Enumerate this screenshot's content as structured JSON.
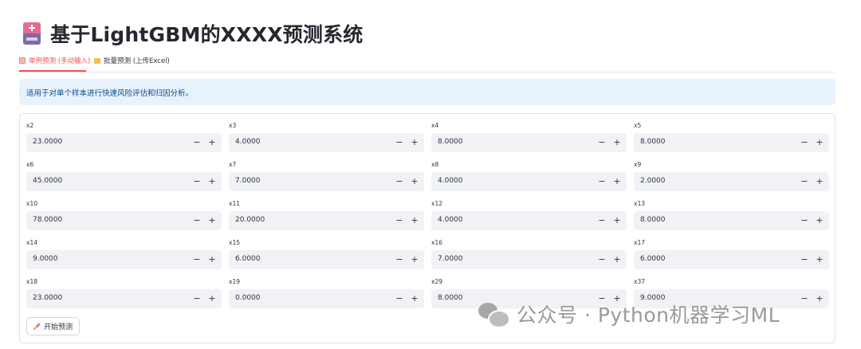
{
  "header": {
    "title": "基于LightGBM的XXXX预测系统",
    "icon": "hospital-icon"
  },
  "tabs": [
    {
      "label": "单例预测 (手动输入)",
      "icon": "memo-icon",
      "active": true
    },
    {
      "label": "批量预测 (上传Excel)",
      "icon": "folder-icon",
      "active": false
    }
  ],
  "info": {
    "text": "适用于对单个样本进行快速风险评估和归因分析。"
  },
  "fields": [
    {
      "label": "x2",
      "value": "23.0000"
    },
    {
      "label": "x3",
      "value": "4.0000"
    },
    {
      "label": "x4",
      "value": "8.0000"
    },
    {
      "label": "x5",
      "value": "8.0000"
    },
    {
      "label": "x6",
      "value": "45.0000"
    },
    {
      "label": "x7",
      "value": "7.0000"
    },
    {
      "label": "x8",
      "value": "4.0000"
    },
    {
      "label": "x9",
      "value": "2.0000"
    },
    {
      "label": "x10",
      "value": "78.0000"
    },
    {
      "label": "x11",
      "value": "20.0000"
    },
    {
      "label": "x12",
      "value": "4.0000"
    },
    {
      "label": "x13",
      "value": "8.0000"
    },
    {
      "label": "x14",
      "value": "9.0000"
    },
    {
      "label": "x15",
      "value": "6.0000"
    },
    {
      "label": "x16",
      "value": "7.0000"
    },
    {
      "label": "x17",
      "value": "6.0000"
    },
    {
      "label": "x18",
      "value": "23.0000"
    },
    {
      "label": "x19",
      "value": "0.0000"
    },
    {
      "label": "x29",
      "value": "8.0000"
    },
    {
      "label": "x37",
      "value": "9.0000"
    }
  ],
  "stepper": {
    "minus": "−",
    "plus": "+"
  },
  "button": {
    "label": "开始预测",
    "icon": "rocket-icon"
  },
  "watermark": {
    "text": "公众号 · Python机器学习ML",
    "icon": "wechat-icon"
  },
  "colors": {
    "accent": "#ff4b4b",
    "info_bg": "#e8f2fc",
    "info_text": "#0b4c8c",
    "input_bg": "#f0f2f6"
  }
}
